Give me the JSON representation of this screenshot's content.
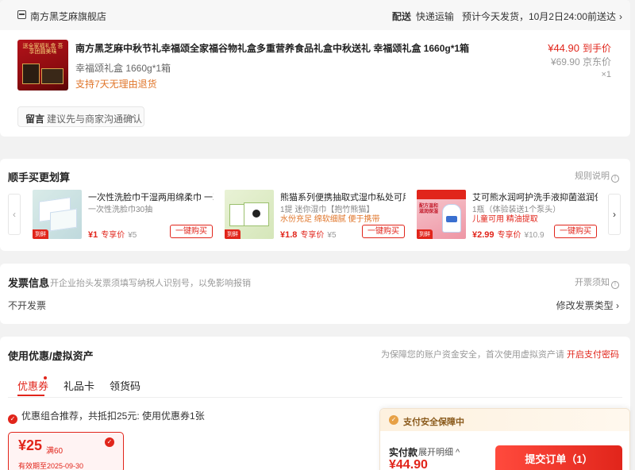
{
  "store": {
    "name": "南方黑芝麻旗舰店",
    "ship_label": "配送",
    "ship_method": "快递运输",
    "ship_eta": "预计今天发货，10月2日24:00前送达",
    "ship_arrow": "›"
  },
  "product": {
    "title": "南方黑芝麻中秋节礼幸福颂全家福谷物礼盒多重营养食品礼盒中秋送礼 幸福颂礼盒 1660g*1箱",
    "image_text": "送全家福礼盒 吾享团圆美味",
    "spec": "幸福颂礼盒 1660g*1箱",
    "return_policy": "支持7天无理由退货",
    "price": "¥44.90",
    "price_label": "到手价",
    "orig_price": "¥69.90",
    "orig_label": "京东价",
    "qty": "×1"
  },
  "message": {
    "label": "留言",
    "placeholder": "建议先与商家沟通确认",
    "chevron": "⌄"
  },
  "addon": {
    "title": "顺手买更划算",
    "rules": "规则说明",
    "info": "!",
    "prev": "‹",
    "next": "›",
    "items": [
      {
        "title": "一次性洗脸巾干湿两用绵柔巾 一次",
        "sub": "一次性洗脸巾30抽",
        "tag": "",
        "price": "¥1",
        "price_label": "专享价",
        "orig": "¥5",
        "buy": "一键购买",
        "badge": "到鲜"
      },
      {
        "title": "熊猫系列便携抽取式湿巾私处可用",
        "sub": "1提 迷你湿巾【抱竹熊猫】",
        "tag": "水份充足 绵软细腻 便于携带",
        "price": "¥1.8",
        "price_label": "专享价",
        "orig": "¥5",
        "buy": "一键购买",
        "badge": "到鲜"
      },
      {
        "title": "艾可熊水润呵护洗手液抑菌滋润保",
        "sub": "1瓶（体验装送1个泵头）",
        "tag": "儿童可用 精油提取",
        "price": "¥2.99",
        "price_label": "专享价",
        "orig": "¥10.9",
        "buy": "一键购买",
        "badge": "到鲜",
        "image_text": "配方温和 滋润保湿"
      }
    ]
  },
  "invoice": {
    "title": "发票信息",
    "hint": "开企业抬头发票须填写纳税人识别号，以免影响报销",
    "notice": "开票须知",
    "info": "!",
    "type": "不开发票",
    "edit": "修改发票类型",
    "arrow": "›"
  },
  "coupon": {
    "title": "使用优惠/虚拟资产",
    "hint": "为保障您的账户资金安全，首次使用虚拟资产请",
    "hint_link": "开启支付密码",
    "tabs": [
      "优惠券",
      "礼品卡",
      "领货码"
    ],
    "combo_text": "优惠组合推荐，共抵扣25元: 使用优惠券1张",
    "check": "✓",
    "tile": {
      "amount": "¥25",
      "condition": "满60",
      "valid": "有效期至2025-09-30"
    }
  },
  "payment": {
    "security": "支付安全保障中",
    "shield": "✓",
    "label": "实付款",
    "detail": "展开明细 ^",
    "amount": "¥44.90",
    "submit": "提交订单（1）"
  },
  "colors": {
    "accent": "#e1251b",
    "orange": "#e0762b",
    "gold": "#8a5a1c"
  }
}
